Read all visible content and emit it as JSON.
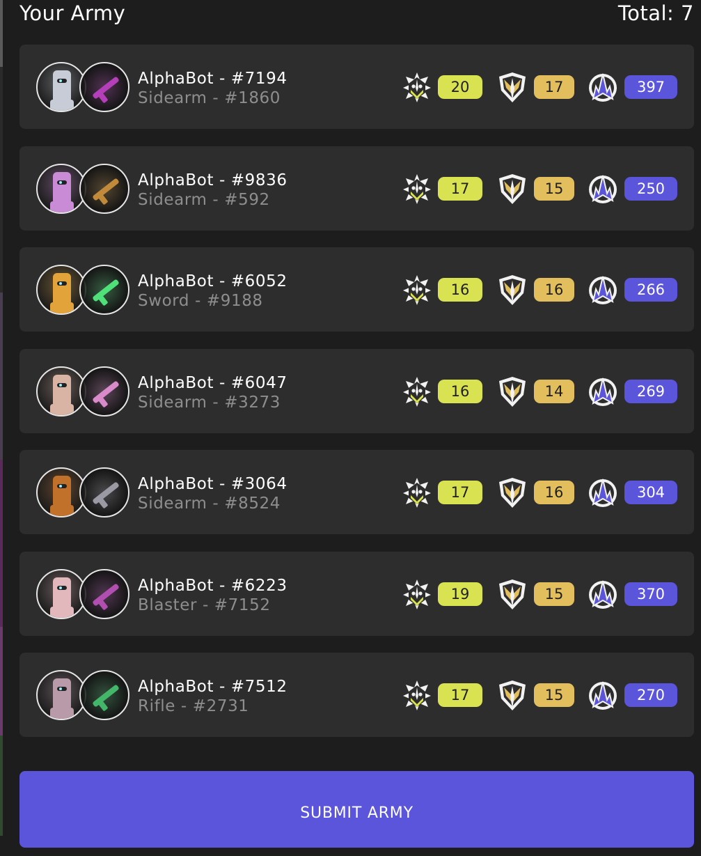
{
  "header": {
    "title": "Your Army",
    "total": "Total: 7"
  },
  "stat_icons": {
    "attack": "attack-emblem-icon",
    "defense": "defense-shield-icon",
    "power": "power-crest-icon"
  },
  "colors": {
    "background": "#1d1d1d",
    "card": "#2d2d2d",
    "attack": "#d9e250",
    "defense": "#e2bf5c",
    "power": "#5b55dc"
  },
  "army": [
    {
      "bot": "AlphaBot - #7194",
      "weapon": "Sidearm - #1860",
      "attack": "20",
      "defense": "17",
      "power": "397",
      "bot_color": "#c7ccd6",
      "weapon_color": "#b43fb8"
    },
    {
      "bot": "AlphaBot - #9836",
      "weapon": "Sidearm - #592",
      "attack": "17",
      "defense": "15",
      "power": "250",
      "bot_color": "#c98ad6",
      "weapon_color": "#c08a3a"
    },
    {
      "bot": "AlphaBot - #6052",
      "weapon": "Sword - #9188",
      "attack": "16",
      "defense": "16",
      "power": "266",
      "bot_color": "#e2a43a",
      "weapon_color": "#4fe07a"
    },
    {
      "bot": "AlphaBot - #6047",
      "weapon": "Sidearm - #3273",
      "attack": "16",
      "defense": "14",
      "power": "269",
      "bot_color": "#d9b4a4",
      "weapon_color": "#d88acb"
    },
    {
      "bot": "AlphaBot - #3064",
      "weapon": "Sidearm - #8524",
      "attack": "17",
      "defense": "16",
      "power": "304",
      "bot_color": "#c2712a",
      "weapon_color": "#9a9aa4"
    },
    {
      "bot": "AlphaBot - #6223",
      "weapon": "Blaster - #7152",
      "attack": "19",
      "defense": "15",
      "power": "370",
      "bot_color": "#e3b8bc",
      "weapon_color": "#b04fb0"
    },
    {
      "bot": "AlphaBot - #7512",
      "weapon": "Rifle - #2731",
      "attack": "17",
      "defense": "15",
      "power": "270",
      "bot_color": "#b99aa8",
      "weapon_color": "#43b66a"
    }
  ],
  "submit": {
    "label": "SUBMIT ARMY"
  }
}
